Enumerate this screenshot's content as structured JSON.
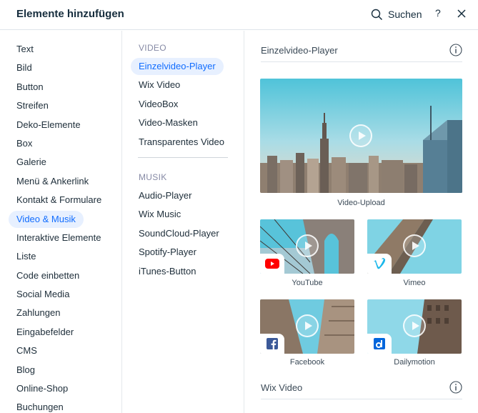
{
  "header": {
    "title": "Elemente hinzufügen",
    "search_label": "Suchen",
    "help_label": "?"
  },
  "categories": [
    "Text",
    "Bild",
    "Button",
    "Streifen",
    "Deko-Elemente",
    "Box",
    "Galerie",
    "Menü & Ankerlink",
    "Kontakt & Formulare",
    "Video & Musik",
    "Interaktive Elemente",
    "Liste",
    "Code einbetten",
    "Social Media",
    "Zahlungen",
    "Eingabefelder",
    "CMS",
    "Blog",
    "Online-Shop",
    "Buchungen"
  ],
  "active_category": "Video & Musik",
  "video_section": {
    "label": "VIDEO",
    "items": [
      "Einzelvideo-Player",
      "Wix Video",
      "VideoBox",
      "Video-Masken",
      "Transparentes Video"
    ]
  },
  "music_section": {
    "label": "MUSIK",
    "items": [
      "Audio-Player",
      "Wix Music",
      "SoundCloud-Player",
      "Spotify-Player",
      "iTunes-Button"
    ]
  },
  "active_subitem": "Einzelvideo-Player",
  "main": {
    "section1_title": "Einzelvideo-Player",
    "hero_caption": "Video-Upload",
    "tiles": [
      {
        "caption": "YouTube",
        "icon": "youtube-icon"
      },
      {
        "caption": "Vimeo",
        "icon": "vimeo-icon"
      },
      {
        "caption": "Facebook",
        "icon": "facebook-icon"
      },
      {
        "caption": "Dailymotion",
        "icon": "dailymotion-icon"
      }
    ],
    "section2_title": "Wix Video"
  },
  "colors": {
    "accent": "#116dff",
    "active_bg": "#e7f0ff",
    "youtube": "#ff0000",
    "vimeo": "#1ab7ea",
    "facebook": "#3b5998",
    "dailymotion": "#0066dc"
  }
}
